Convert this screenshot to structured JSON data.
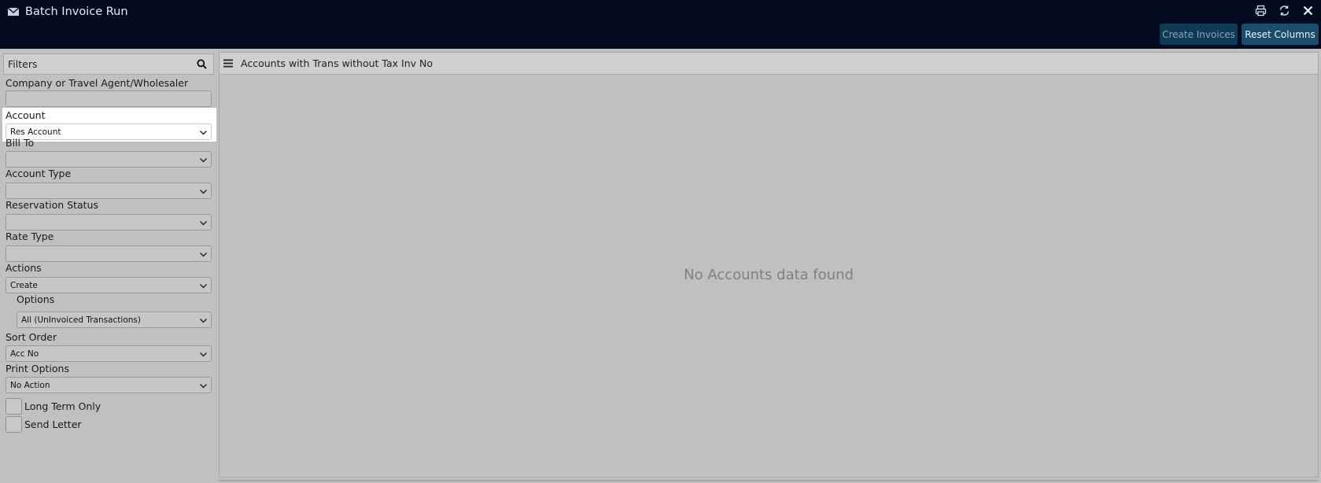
{
  "window": {
    "title": "Batch Invoice Run",
    "icons": [
      "mail-icon",
      "print-icon",
      "refresh-icon",
      "close-icon"
    ]
  },
  "toolbar": {
    "create_invoices": "Create Invoices",
    "reset_columns": "Reset Columns"
  },
  "filters": {
    "header": "Filters",
    "company_label": "Company or Travel Agent/Wholesaler",
    "company_value": "",
    "account_label": "Account",
    "account_value": "Res Account",
    "bill_to_label": "Bill To",
    "bill_to_value": "",
    "account_type_label": "Account Type",
    "account_type_value": "",
    "reservation_status_label": "Reservation Status",
    "reservation_status_value": "",
    "rate_type_label": "Rate Type",
    "rate_type_value": "",
    "actions_label": "Actions",
    "actions_value": "Create",
    "options_label": "Options",
    "options_value": "All (UnInvoiced Transactions)",
    "sort_order_label": "Sort Order",
    "sort_order_value": "Acc No",
    "print_options_label": "Print Options",
    "print_options_value": "No Action",
    "long_term_only_label": "Long Term Only",
    "long_term_only_checked": false,
    "send_letter_label": "Send Letter",
    "send_letter_checked": false
  },
  "grid": {
    "title": "Accounts with Trans without Tax Inv No",
    "empty_message": "No Accounts data found"
  },
  "colors": {
    "titlebar": "#020a1d",
    "panel_bg": "#c0c0c0",
    "button_primary": "#1a4c6c"
  }
}
